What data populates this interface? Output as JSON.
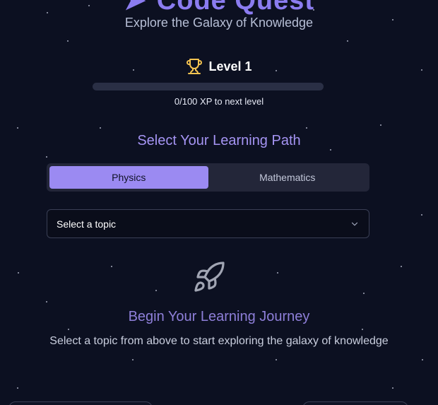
{
  "app": {
    "title": "Code Quest",
    "subtitle": "Explore the Galaxy of Knowledge"
  },
  "level": {
    "label": "Level 1",
    "xp_current": 0,
    "xp_max": 100,
    "xp_text": "0/100 XP to next level",
    "icon": "trophy-icon"
  },
  "path": {
    "heading": "Select Your Learning Path",
    "tabs": [
      {
        "label": "Physics",
        "active": true
      },
      {
        "label": "Mathematics",
        "active": false
      }
    ]
  },
  "topic_select": {
    "value": "Select a topic",
    "icon": "chevron-down-icon"
  },
  "journey": {
    "icon": "rocket-icon",
    "heading": "Begin Your Learning Journey",
    "text": "Select a topic from above to start exploring the galaxy of knowledge"
  },
  "colors": {
    "background": "#0c1021",
    "accent": "#9b8af2",
    "trophy": "#f5c451"
  }
}
